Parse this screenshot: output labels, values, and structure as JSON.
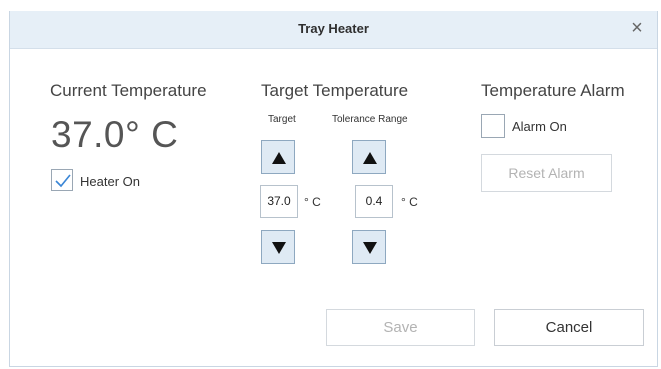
{
  "dialog": {
    "title": "Tray Heater",
    "close_symbol": "×"
  },
  "current": {
    "heading": "Current Temperature",
    "value": "37.0° C",
    "heater_label": "Heater On",
    "heater_checked": true
  },
  "target": {
    "heading": "Target Temperature",
    "target_label": "Target",
    "tolerance_label": "Tolerance Range",
    "target_value": "37.0",
    "tolerance_value": "0.4",
    "unit": "° C"
  },
  "alarm": {
    "heading": "Temperature Alarm",
    "alarm_label": "Alarm On",
    "alarm_checked": false,
    "reset_label": "Reset Alarm"
  },
  "footer": {
    "save_label": "Save",
    "cancel_label": "Cancel"
  },
  "icons": {
    "up": "triangle-up-icon",
    "down": "triangle-down-icon",
    "check": "checkmark-icon",
    "close": "close-icon"
  },
  "colors": {
    "titlebar": "#e6eff7",
    "stepper_bg": "#dfeaf4",
    "check": "#3a86d6"
  }
}
